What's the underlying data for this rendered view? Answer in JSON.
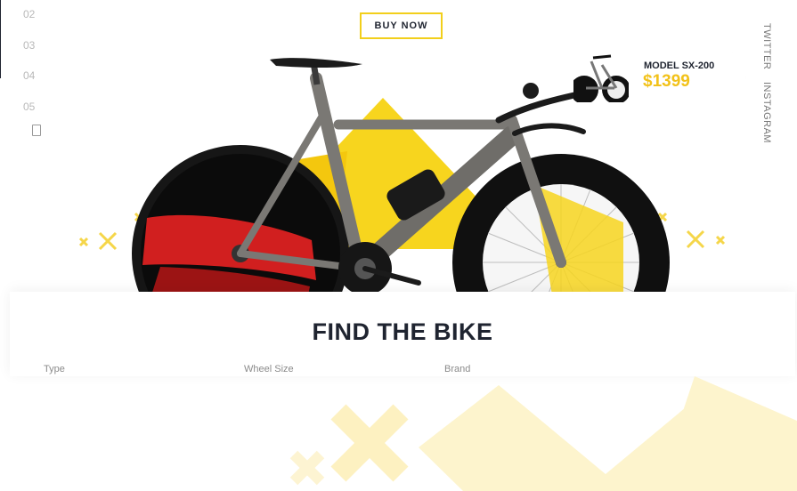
{
  "slide_nav": {
    "numbers": [
      "02",
      "03",
      "04",
      "05"
    ]
  },
  "hero": {
    "buy_label": "BUY NOW"
  },
  "social": {
    "twitter": "TWITTER",
    "instagram": "INSTAGRAM"
  },
  "product": {
    "model": "MODEL SX-200",
    "price": "$1399"
  },
  "finder": {
    "title": "FIND THE BIKE",
    "filters": [
      "Type",
      "Wheel Size",
      "Brand"
    ]
  },
  "colors": {
    "accent": "#f2cf1b",
    "dark": "#1f2430",
    "red": "#d11f1f"
  }
}
